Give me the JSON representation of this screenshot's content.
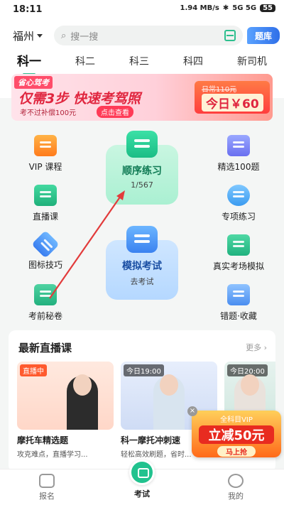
{
  "status": {
    "time": "18:11",
    "net": "1.94 MB/s",
    "signal": "5G 5G",
    "battery": "55"
  },
  "header": {
    "city": "福州",
    "search_placeholder": "搜一搜",
    "tiku": "题库"
  },
  "tabs": [
    "科一",
    "科二",
    "科三",
    "科四",
    "新司机"
  ],
  "banner": {
    "tag": "省心驾考",
    "main": "仅需3步 快速考驾照",
    "sub": "考不过补偿100元",
    "cta": "点击查看",
    "old_price": "日常110元",
    "today": "今日￥60"
  },
  "grid": {
    "vip": "VIP 课程",
    "live": "直播课",
    "tips": "图标技巧",
    "secret": "考前秘卷",
    "seq_title": "顺序练习",
    "seq_progress": "1/567",
    "mock_title": "模拟考试",
    "mock_sub": "去考试",
    "select100": "精选100题",
    "special": "专项练习",
    "real": "真实考场模拟",
    "wrong": "错题·收藏"
  },
  "live": {
    "title": "最新直播课",
    "more": "更多",
    "cards": [
      {
        "badge": "直播中",
        "title": "摩托车精选题",
        "sub": "攻克难点，直播学习..."
      },
      {
        "badge": "今日19:00",
        "title": "科一摩托冲刺速",
        "sub": "轻松高效刷题，省时..."
      },
      {
        "badge": "今日20:00",
        "title": "",
        "sub": ""
      }
    ]
  },
  "vip_float": {
    "line1": "全科目VIP",
    "line2": "立减50元",
    "cta": "马上抢"
  },
  "nav": {
    "left": "报名",
    "center": "考试",
    "right": "我的"
  },
  "colors": {
    "accent": "#21c28e",
    "arrow": "#e23b3b"
  }
}
